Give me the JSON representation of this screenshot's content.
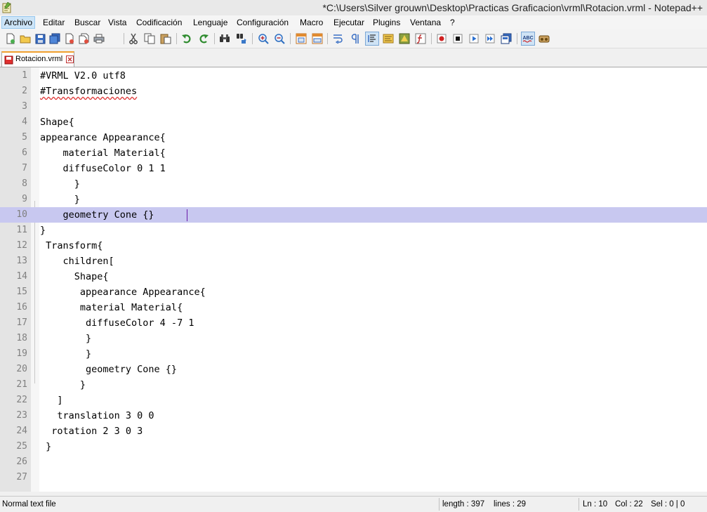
{
  "window": {
    "title": "*C:\\Users\\Silver grouwn\\Desktop\\Practicas Graficacion\\vrml\\Rotacion.vrml - Notepad++"
  },
  "menu": [
    "Archivo",
    "Editar",
    "Buscar",
    "Vista",
    "Codificación",
    "Lenguaje",
    "Configuración",
    "Macro",
    "Ejecutar",
    "Plugins",
    "Ventana",
    "?"
  ],
  "toolbar": {
    "icons": [
      "new-file-icon",
      "open-file-icon",
      "save-icon",
      "save-all-icon",
      "close-icon",
      "close-all-icon",
      "print-icon",
      "cut-icon",
      "copy-icon",
      "paste-icon",
      "undo-icon",
      "redo-icon",
      "find-icon",
      "replace-icon",
      "zoom-in-icon",
      "zoom-out-icon",
      "sync-vertical-icon",
      "sync-horizontal-icon",
      "word-wrap-icon",
      "show-all-chars-icon",
      "indent-guide-icon",
      "user-language-icon",
      "doc-map-icon",
      "function-list-icon",
      "record-macro-icon",
      "stop-macro-icon",
      "play-macro-icon",
      "run-macro-multiple-icon",
      "save-macro-icon",
      "spell-check-icon",
      "plugin-icon"
    ]
  },
  "tab": {
    "label": "Rotacion.vrml",
    "icon": "unsaved-file-icon"
  },
  "editor": {
    "current_line": 10,
    "lines": [
      "#VRML V2.0 utf8",
      "#Transformaciones",
      "",
      "Shape{",
      "appearance Appearance{",
      "    material Material{",
      "    diffuseColor 0 1 1",
      "      }",
      "      }",
      "    geometry Cone {} ",
      "}",
      " Transform{",
      "    children[",
      "      Shape{",
      "       appearance Appearance{",
      "       material Material{",
      "        diffuseColor 4 -7 1",
      "        }",
      "        }",
      "        geometry Cone {}",
      "       }",
      "   ]",
      "   translation 3 0 0",
      "  rotation 2 3 0 3",
      " }",
      "",
      ""
    ]
  },
  "status": {
    "file_type": "Normal text file",
    "length": "length : 397",
    "lines": "lines : 29",
    "ln": "Ln : 10",
    "col": "Col : 22",
    "sel": "Sel : 0 | 0"
  }
}
